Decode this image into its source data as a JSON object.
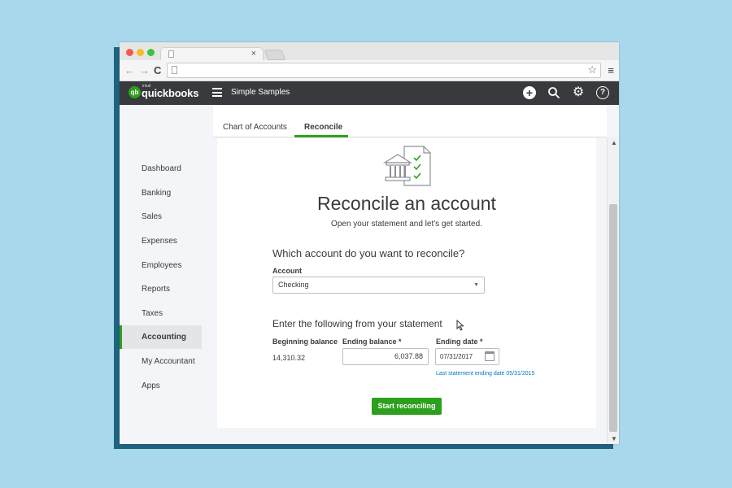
{
  "browser": {
    "tab_close": "×",
    "nav_back": "←",
    "nav_forward": "→",
    "nav_reload": "C",
    "star": "☆",
    "menu": "≡"
  },
  "header": {
    "logo_badge": "qb",
    "logo_small": "intuit",
    "logo_text": "quickbooks",
    "company_name": "Simple Samples",
    "plus_icon": "+",
    "search_icon": "⚲",
    "gear_icon": "⚙",
    "help_icon": "?"
  },
  "sidebar": {
    "items": [
      {
        "label": "Dashboard"
      },
      {
        "label": "Banking"
      },
      {
        "label": "Sales"
      },
      {
        "label": "Expenses"
      },
      {
        "label": "Employees"
      },
      {
        "label": "Reports"
      },
      {
        "label": "Taxes"
      },
      {
        "label": "Accounting",
        "active": true
      },
      {
        "label": "My Accountant"
      },
      {
        "label": "Apps"
      }
    ]
  },
  "tabs": [
    {
      "label": "Chart of Accounts"
    },
    {
      "label": "Reconcile",
      "active": true
    }
  ],
  "main": {
    "heading": "Reconcile an account",
    "subheading": "Open your statement and let's get started.",
    "question_account": "Which account do you want to reconcile?",
    "account_label": "Account",
    "account_value": "Checking",
    "question_statement": "Enter the following from your statement",
    "beginning_balance_label": "Beginning balance",
    "beginning_balance_value": "14,310.32",
    "ending_balance_label": "Ending balance *",
    "ending_balance_value": "6,037.88",
    "ending_date_label": "Ending date *",
    "ending_date_value": "07/31/2017",
    "last_statement": "Last statement ending date 05/31/2015",
    "start_button": "Start reconciling"
  },
  "colors": {
    "brand_green": "#2ca01c",
    "header_dark": "#393a3d",
    "link_blue": "#0077c5",
    "background": "#a9d8ec"
  }
}
